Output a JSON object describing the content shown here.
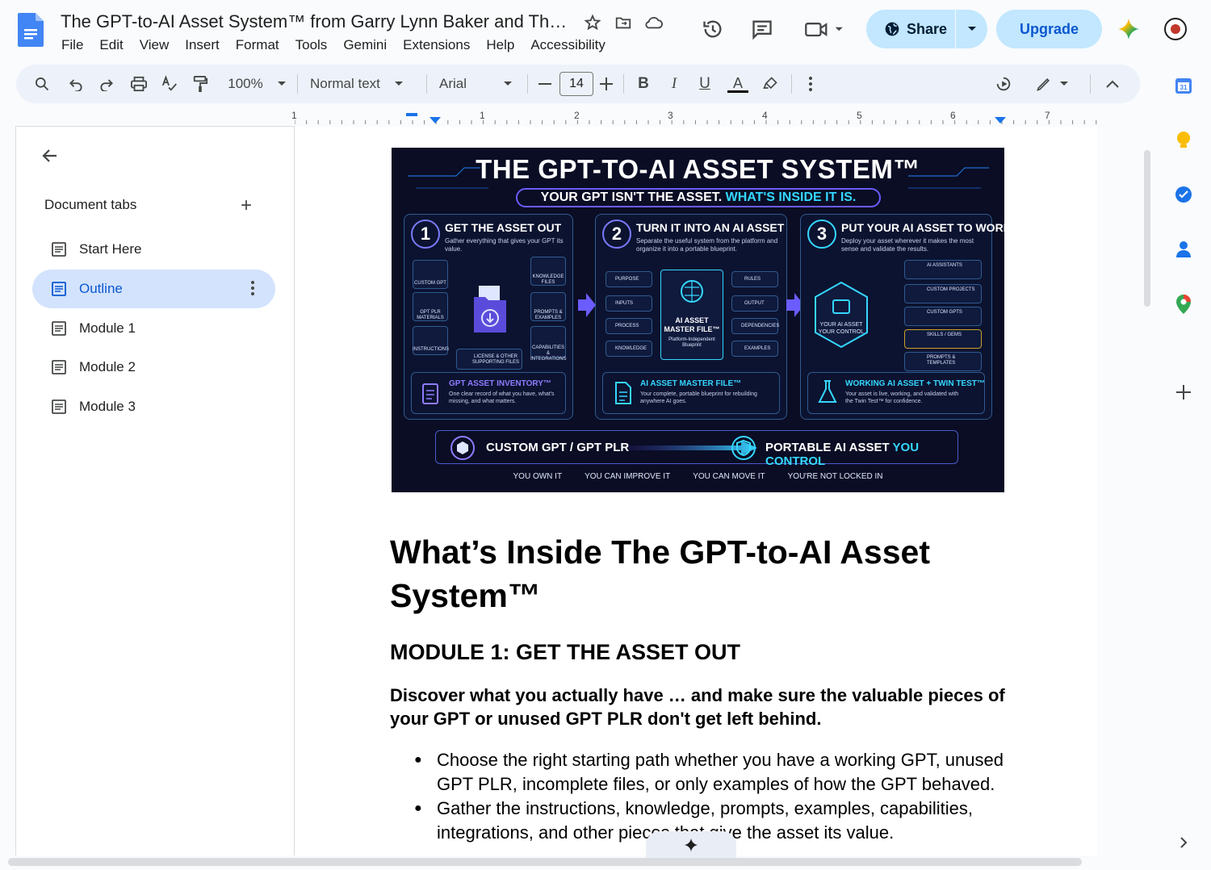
{
  "document": {
    "title": "The GPT-to-AI Asset System™ from Garry Lynn Baker and Thirt...",
    "menu": [
      "File",
      "Edit",
      "View",
      "Insert",
      "Format",
      "Tools",
      "Gemini",
      "Extensions",
      "Help",
      "Accessibility"
    ]
  },
  "header": {
    "share_label": "Share",
    "upgrade_label": "Upgrade"
  },
  "toolbar": {
    "zoom": "100%",
    "style": "Normal text",
    "font": "Arial",
    "font_size": "14"
  },
  "ruler": {
    "labels": [
      "1",
      "1",
      "2",
      "3",
      "4",
      "5",
      "6",
      "7"
    ]
  },
  "sidebar": {
    "header": "Document tabs",
    "tabs": [
      {
        "label": "Start Here",
        "active": false
      },
      {
        "label": "Outline",
        "active": true
      },
      {
        "label": "Module 1",
        "active": false
      },
      {
        "label": "Module 2",
        "active": false
      },
      {
        "label": "Module 3",
        "active": false
      }
    ]
  },
  "infographic": {
    "title": "THE GPT-TO-AI ASSET SYSTEM™",
    "subtitle_a": "YOUR GPT ISN'T THE ASSET.",
    "subtitle_b": "WHAT'S INSIDE IT IS.",
    "panels": [
      {
        "num": "1",
        "head": "GET THE ASSET OUT",
        "desc": "Gather everything that gives your GPT its value.",
        "foot_title": "GPT ASSET INVENTORY™",
        "foot_desc": "One clear record of what you have, what's missing, and what matters."
      },
      {
        "num": "2",
        "head": "TURN IT INTO AN AI ASSET",
        "desc": "Separate the useful system from the platform and organize it into a portable blueprint.",
        "foot_title": "AI ASSET MASTER FILE™",
        "foot_desc": "Your complete, portable blueprint for rebuilding anywhere AI goes."
      },
      {
        "num": "3",
        "head": "PUT YOUR AI ASSET TO WORK",
        "desc": "Deploy your asset wherever it makes the most sense and validate the results.",
        "foot_title": "WORKING AI ASSET + TWIN TEST™",
        "foot_desc": "Your asset is live, working, and validated with the Twin Test™ for confidence."
      }
    ],
    "panel1_items": [
      "CUSTOM GPT",
      "GPT PLR MATERIALS",
      "INSTRUCTIONS",
      "KNOWLEDGE FILES",
      "PROMPTS & EXAMPLES",
      "CAPABILITIES & INTEGRATIONS",
      "LICENSE & OTHER SUPPORTING FILES"
    ],
    "panel2_left": [
      "PURPOSE",
      "INPUTS",
      "PROCESS",
      "KNOWLEDGE"
    ],
    "panel2_right": [
      "RULES",
      "OUTPUT",
      "DEPENDENCIES",
      "EXAMPLES"
    ],
    "panel2_center": "AI ASSET MASTER FILE™",
    "panel2_center_sub": "Platform-Independent Blueprint",
    "panel3_center": "YOUR AI ASSET YOUR CONTROL",
    "panel3_items": [
      "AI ASSISTANTS",
      "CUSTOM PROJECTS",
      "CUSTOM GPTS",
      "SKILLS / GEMS",
      "PROMPTS & TEMPLATES"
    ],
    "banner_left": "CUSTOM GPT / GPT PLR",
    "banner_right_a": "PORTABLE AI ASSET",
    "banner_right_b": "YOU CONTROL",
    "benefits": [
      "YOU OWN IT",
      "YOU CAN IMPROVE IT",
      "YOU CAN MOVE IT",
      "YOU'RE NOT LOCKED IN"
    ]
  },
  "content": {
    "heading": "What’s Inside The GPT-to-AI Asset System™",
    "module_heading": "MODULE 1: GET THE ASSET OUT",
    "lead": "Discover what you actually have … and make sure the valuable pieces of your GPT or unused GPT PLR don't get left behind.",
    "bullets": [
      "Choose the right starting path whether you have a working GPT, unused GPT PLR, incomplete files, or only examples of how the GPT behaved.",
      "Gather the instructions, knowledge, prompts, examples, capabilities, integrations, and other pieces that give the asset its value."
    ]
  },
  "colors": {
    "accent": "#0b57d0",
    "share_bg": "#c2e7ff",
    "active_tab_bg": "#d3e3fd",
    "infographic_bg": "#0a0d24",
    "infographic_accent": "#35d7ff"
  }
}
